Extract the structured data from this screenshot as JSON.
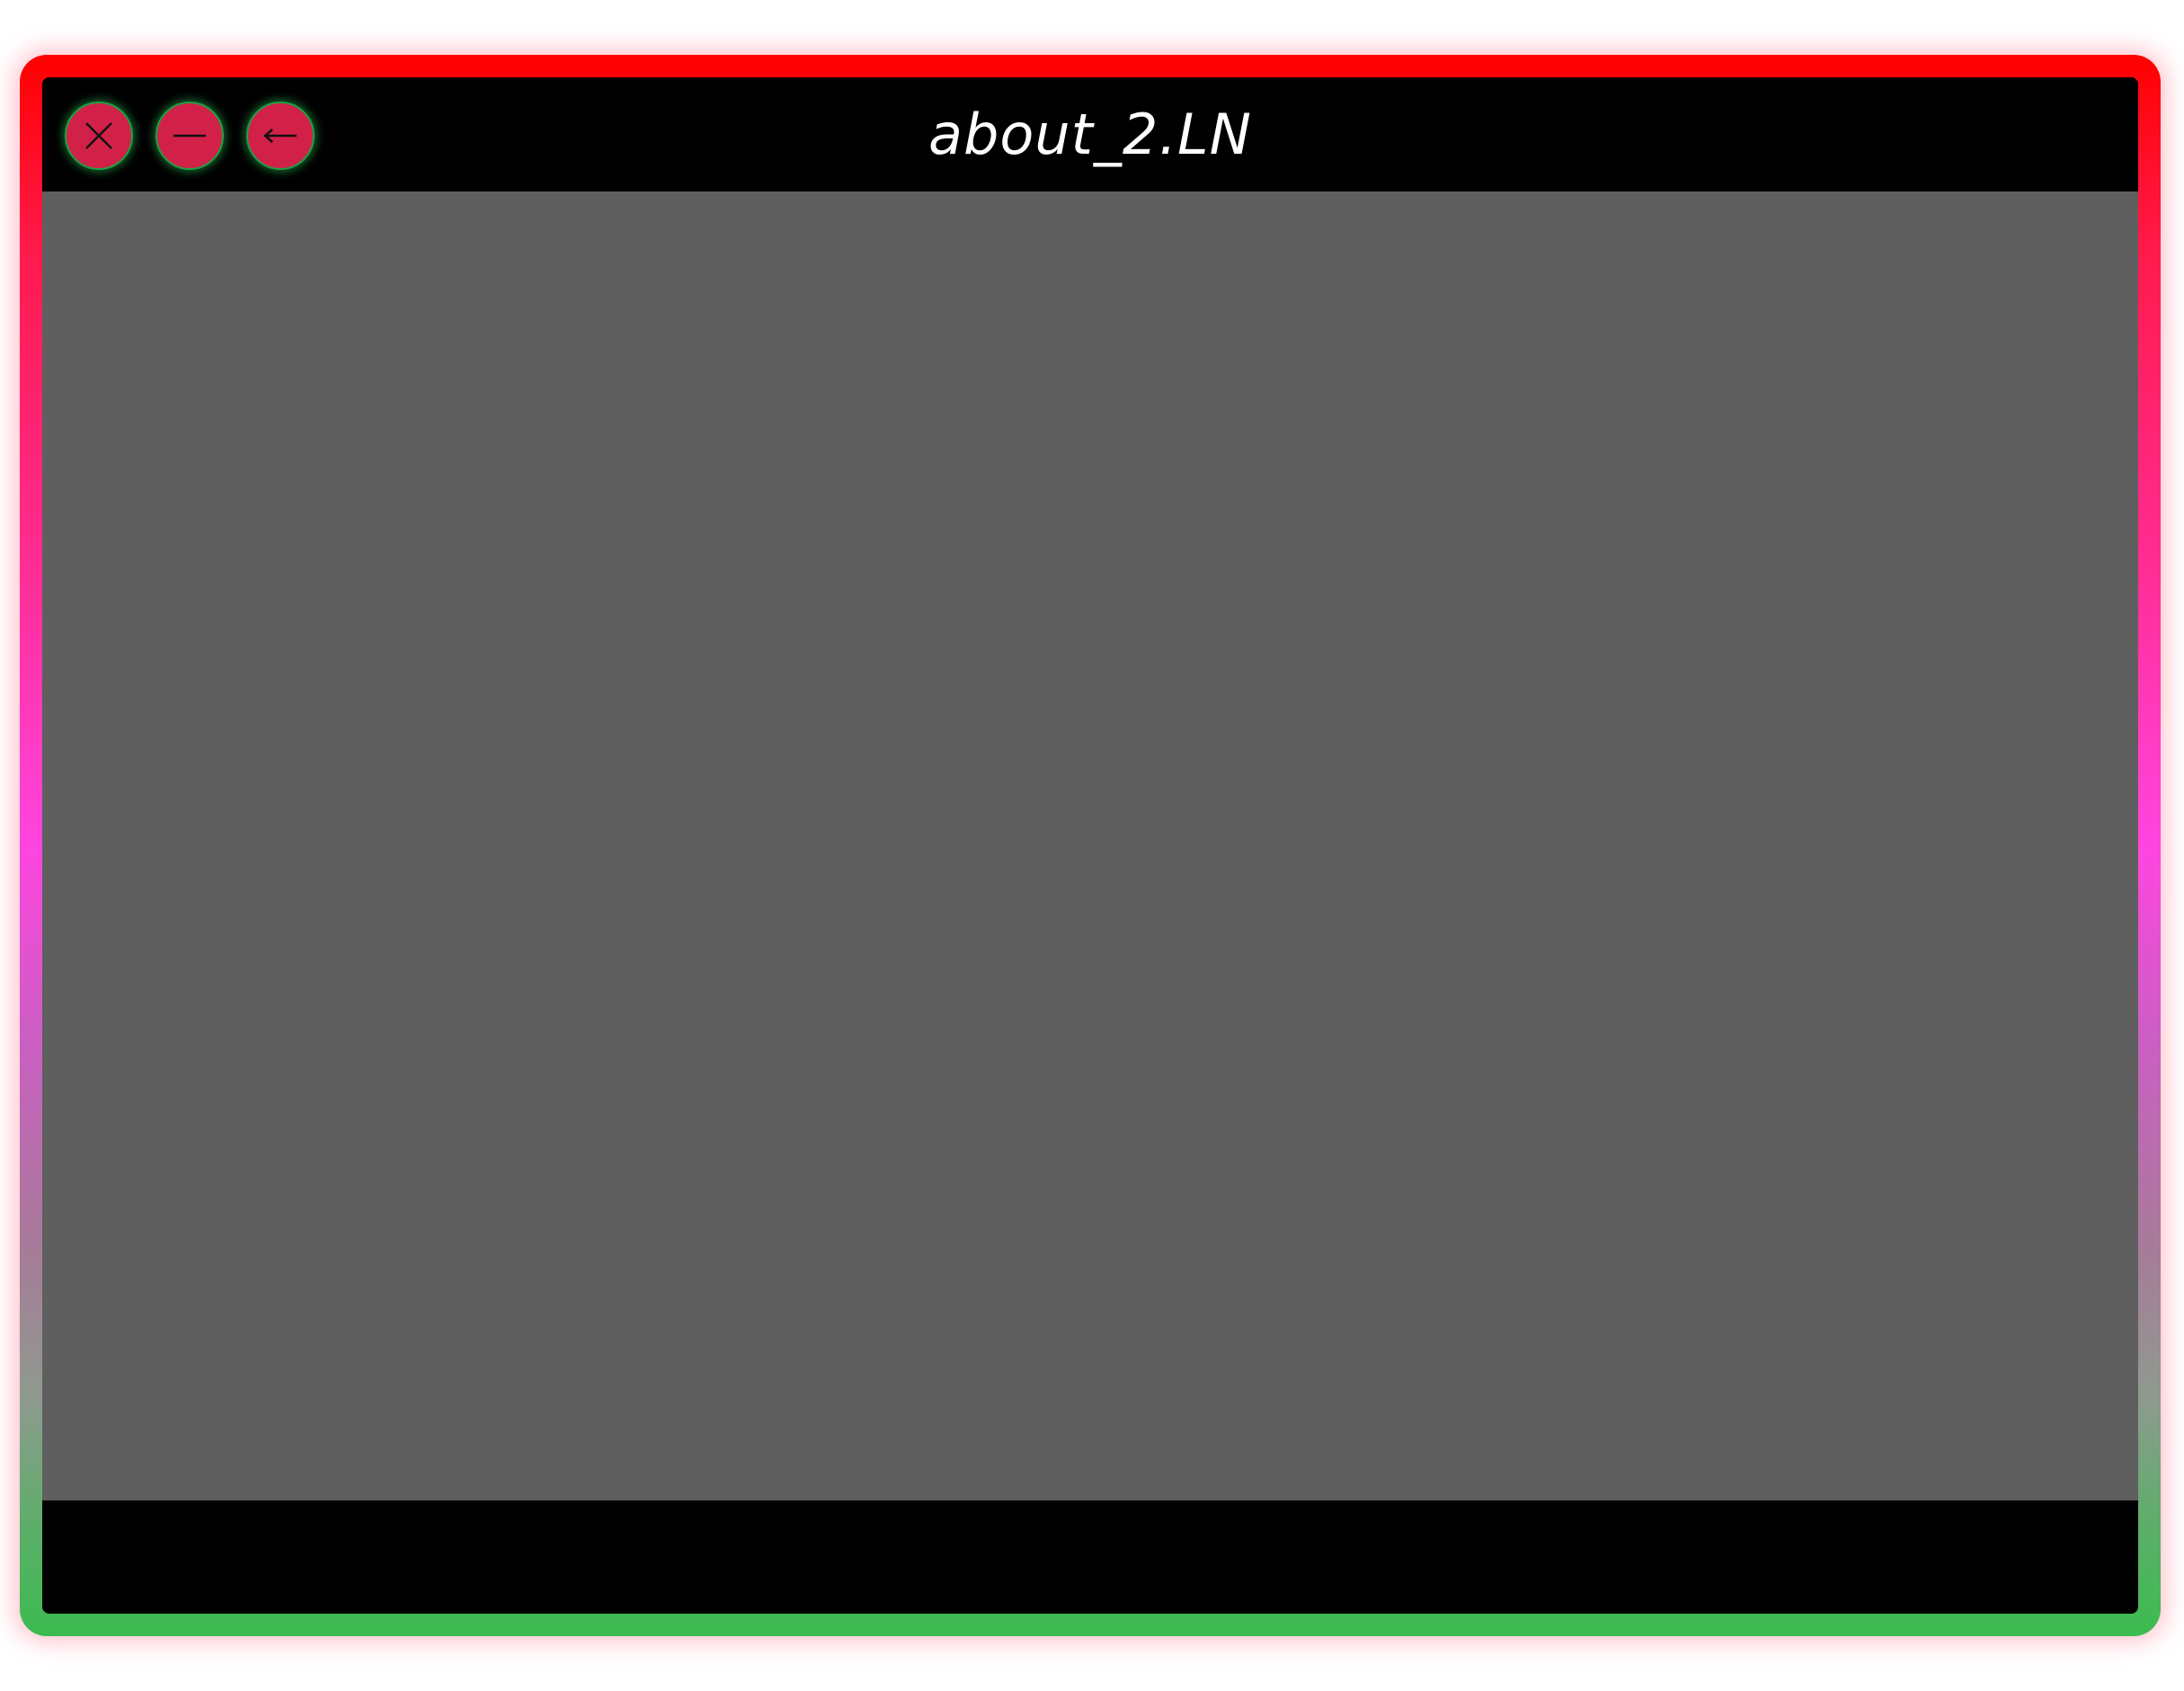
{
  "window": {
    "title": "about_2.LN"
  },
  "controls": {
    "close": {
      "icon": "close-icon"
    },
    "minimize": {
      "icon": "minimize-icon"
    },
    "back": {
      "icon": "back-arrow-icon"
    }
  },
  "colors": {
    "frame_top": "#ff0000",
    "frame_middle": "#ff45e0",
    "frame_bottom": "#3bbc4f",
    "button_fill": "#d22148",
    "button_glow": "#1f9e45",
    "content_background": "#5f5f5f",
    "bar_background": "#000000"
  }
}
